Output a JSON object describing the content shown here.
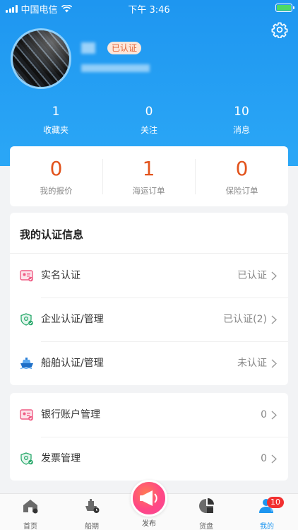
{
  "status_bar": {
    "carrier": "中国电信",
    "time": "下午 3:46"
  },
  "profile": {
    "badge": "已认证"
  },
  "stats": [
    {
      "value": "1",
      "label": "收藏夹"
    },
    {
      "value": "0",
      "label": "关注"
    },
    {
      "value": "10",
      "label": "消息"
    }
  ],
  "orders": [
    {
      "value": "0",
      "label": "我的报价"
    },
    {
      "value": "1",
      "label": "海运订单"
    },
    {
      "value": "0",
      "label": "保险订单"
    }
  ],
  "certification": {
    "title": "我的认证信息",
    "items": [
      {
        "label": "实名认证",
        "value": "已认证",
        "icon": "id-card-icon"
      },
      {
        "label": "企业认证/管理",
        "value": "已认证(2)",
        "icon": "shield-check-icon"
      },
      {
        "label": "船舶认证/管理",
        "value": "未认证",
        "icon": "ship-icon"
      }
    ]
  },
  "accounts": {
    "items": [
      {
        "label": "银行账户管理",
        "value": "0",
        "icon": "id-card-icon"
      },
      {
        "label": "发票管理",
        "value": "0",
        "icon": "shield-check-icon"
      }
    ]
  },
  "tabbar": {
    "items": [
      {
        "label": "首页",
        "icon": "home-icon"
      },
      {
        "label": "船期",
        "icon": "schedule-icon"
      },
      {
        "label": "发布",
        "icon": "megaphone-icon"
      },
      {
        "label": "货盘",
        "icon": "pallet-icon"
      },
      {
        "label": "我的",
        "icon": "user-icon"
      }
    ],
    "badge": "10"
  },
  "colors": {
    "primary": "#1e96f0",
    "accent": "#e2531c",
    "badge": "#f23030"
  }
}
